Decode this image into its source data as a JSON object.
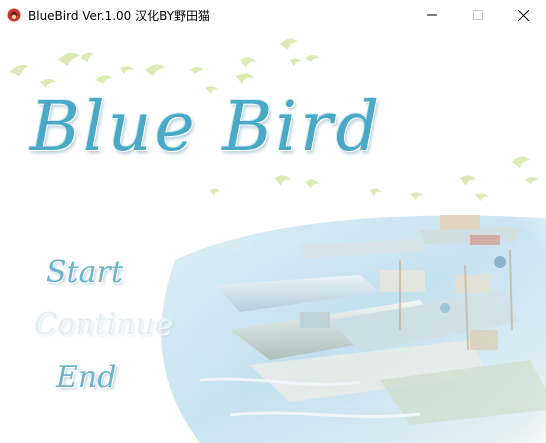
{
  "window": {
    "title": "BlueBird Ver.1.00 汉化BY野田猫",
    "icon": "bird-icon",
    "minimize_icon": "minimize-icon",
    "maximize_icon": "maximize-icon",
    "close_icon": "close-icon"
  },
  "game": {
    "logo_text": "Blue Bird",
    "menu": {
      "start": "Start",
      "continue": "Continue",
      "end": "End"
    },
    "colors": {
      "logo": "#4aa9c6",
      "menu_active": "#6fb4cd",
      "menu_disabled": "#e6eef2",
      "birds": "#d6e7a8"
    }
  }
}
